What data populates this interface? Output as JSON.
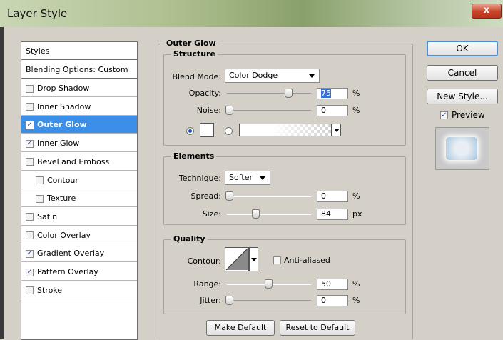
{
  "window": {
    "title": "Layer Style",
    "close_label": "x"
  },
  "styles_list": {
    "header": "Styles",
    "blending": "Blending Options: Custom",
    "items": [
      {
        "label": "Drop Shadow",
        "checked": false
      },
      {
        "label": "Inner Shadow",
        "checked": false
      },
      {
        "label": "Outer Glow",
        "checked": true,
        "selected": true
      },
      {
        "label": "Inner Glow",
        "checked": true
      },
      {
        "label": "Bevel and Emboss",
        "checked": false
      },
      {
        "label": "Contour",
        "checked": false,
        "indent": true
      },
      {
        "label": "Texture",
        "checked": false,
        "indent": true
      },
      {
        "label": "Satin",
        "checked": false
      },
      {
        "label": "Color Overlay",
        "checked": false
      },
      {
        "label": "Gradient Overlay",
        "checked": true
      },
      {
        "label": "Pattern Overlay",
        "checked": true
      },
      {
        "label": "Stroke",
        "checked": false
      }
    ]
  },
  "outer_glow": {
    "title": "Outer Glow",
    "structure": {
      "title": "Structure",
      "blend_mode_label": "Blend Mode:",
      "blend_mode_value": "Color Dodge",
      "opacity_label": "Opacity:",
      "opacity_value": "75",
      "opacity_unit": "%",
      "opacity_level": 0.75,
      "noise_label": "Noise:",
      "noise_value": "0",
      "noise_unit": "%",
      "noise_level": 0,
      "glow_mode": "color",
      "glow_color": "#ffffff"
    },
    "elements": {
      "title": "Elements",
      "technique_label": "Technique:",
      "technique_value": "Softer",
      "spread_label": "Spread:",
      "spread_value": "0",
      "spread_unit": "%",
      "spread_level": 0,
      "size_label": "Size:",
      "size_value": "84",
      "size_unit": "px",
      "size_level": 0.34
    },
    "quality": {
      "title": "Quality",
      "contour_label": "Contour:",
      "anti_aliased_label": "Anti-aliased",
      "anti_aliased_checked": false,
      "range_label": "Range:",
      "range_value": "50",
      "range_unit": "%",
      "range_level": 0.5,
      "jitter_label": "Jitter:",
      "jitter_value": "0",
      "jitter_unit": "%",
      "jitter_level": 0
    },
    "make_default_label": "Make Default",
    "reset_default_label": "Reset to Default"
  },
  "actions": {
    "ok_label": "OK",
    "cancel_label": "Cancel",
    "new_style_label": "New Style...",
    "preview_label": "Preview",
    "preview_checked": true
  },
  "colors": {
    "selection": "#3b8fe8",
    "accent": "#4a8fd8"
  }
}
